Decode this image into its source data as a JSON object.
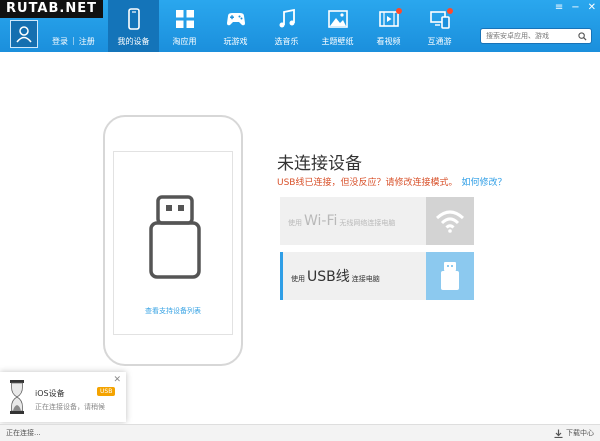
{
  "watermark": "RUTAB.NET",
  "account": {
    "login": "登录",
    "separator": "|",
    "register": "注册"
  },
  "nav": [
    {
      "label": "我的设备",
      "icon": "phone-icon",
      "active": true,
      "dot": false
    },
    {
      "label": "淘应用",
      "icon": "apps-grid-icon",
      "active": false,
      "dot": false
    },
    {
      "label": "玩游戏",
      "icon": "gamepad-icon",
      "active": false,
      "dot": false
    },
    {
      "label": "选音乐",
      "icon": "music-note-icon",
      "active": false,
      "dot": false
    },
    {
      "label": "主题壁纸",
      "icon": "wallpaper-image-icon",
      "active": false,
      "dot": false
    },
    {
      "label": "看视频",
      "icon": "video-film-icon",
      "active": false,
      "dot": true
    },
    {
      "label": "互通游",
      "icon": "cross-device-icon",
      "active": false,
      "dot": true
    }
  ],
  "search": {
    "placeholder": "搜索安卓应用、游戏"
  },
  "window_controls": [
    "≡",
    "−",
    "✕"
  ],
  "device": {
    "phone_link": "查看支持设备列表",
    "title": "未连接设备",
    "hint": "USB线已连接，但没反应？请修改连接模式。",
    "hint_link": "如何修改？",
    "options": {
      "wifi": {
        "prefix": "使用",
        "main": "Wi-Fi",
        "suffix": "无线网络连接电脑"
      },
      "usb": {
        "prefix": "使用",
        "main": "USB线",
        "suffix": "连接电脑"
      }
    }
  },
  "notification": {
    "title": "iOS设备",
    "badge": "USB",
    "subtitle": "正在连接设备，请稍候",
    "close": "✕"
  },
  "status": {
    "text": "正在连接...",
    "download": "下载中心"
  },
  "colors": {
    "topbar": "#1b8fdc",
    "accent": "#2f9ee6",
    "warning": "#d8512a"
  }
}
